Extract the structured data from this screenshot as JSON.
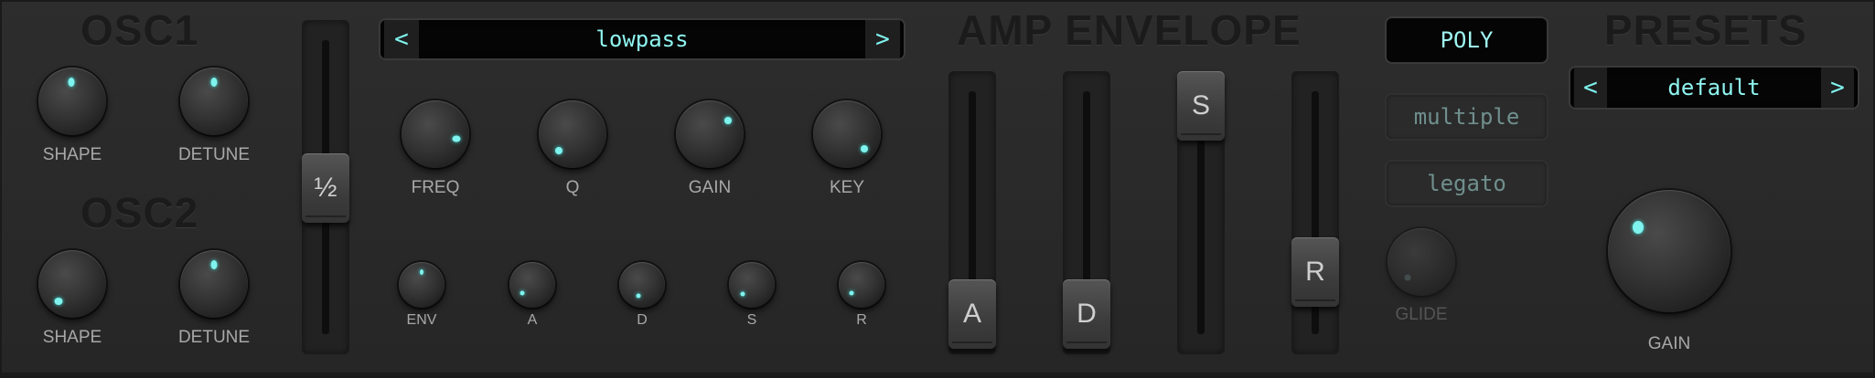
{
  "osc1": {
    "title": "OSC1",
    "shape_label": "SHAPE",
    "detune_label": "DETUNE"
  },
  "osc2": {
    "title": "OSC2",
    "shape_label": "SHAPE",
    "detune_label": "DETUNE"
  },
  "octave_slider": {
    "handle_label": "½"
  },
  "filter": {
    "type_value": "lowpass",
    "prev_arrow": "<",
    "next_arrow": ">",
    "knobs": {
      "freq": "FREQ",
      "q": "Q",
      "gain": "GAIN",
      "key": "KEY"
    },
    "env_knobs": {
      "env": "ENV",
      "a": "A",
      "d": "D",
      "s": "S",
      "r": "R"
    }
  },
  "amp_envelope": {
    "title": "AMP ENVELOPE",
    "a": "A",
    "d": "D",
    "s": "S",
    "r": "R"
  },
  "voice": {
    "poly": "POLY",
    "multiple": "multiple",
    "legato": "legato",
    "glide_label": "GLIDE"
  },
  "presets": {
    "title": "PRESETS",
    "value": "default",
    "prev_arrow": "<",
    "next_arrow": ">",
    "gain_label": "GAIN"
  },
  "colors": {
    "accent": "#7ff3ee",
    "panel": "#2a2a2a",
    "display_bg": "#050505"
  }
}
